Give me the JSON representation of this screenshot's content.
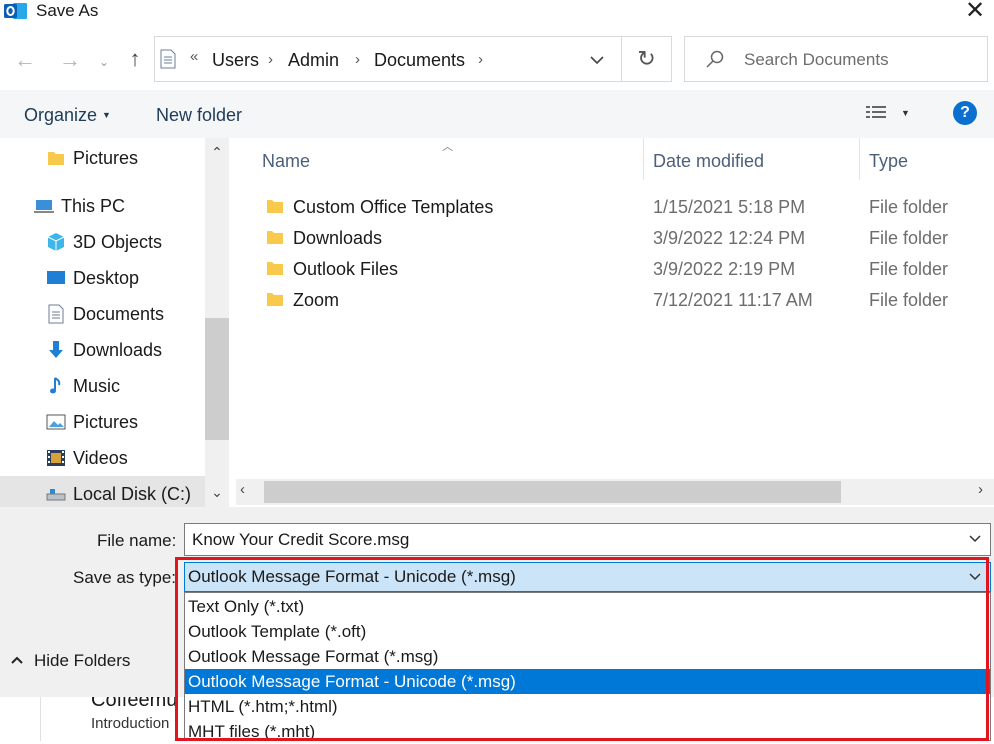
{
  "window": {
    "title": "Save As",
    "close_label": "✕"
  },
  "nav": {
    "back": "←",
    "forward": "→",
    "recent": "⌄",
    "up": "↑",
    "breadcrumb_more": "«",
    "breadcrumbs": [
      "Users",
      "Admin",
      "Documents"
    ],
    "separator": "›",
    "refresh": "↻"
  },
  "search": {
    "placeholder": "Search Documents"
  },
  "toolbar": {
    "organize": "Organize",
    "new_folder": "New folder",
    "help": "?"
  },
  "nav_pane": {
    "items": [
      {
        "label": "Pictures",
        "icon": "folder-icon"
      },
      {
        "label": "This PC",
        "icon": "computer-icon"
      },
      {
        "label": "3D Objects",
        "icon": "3d-objects-icon"
      },
      {
        "label": "Desktop",
        "icon": "desktop-icon"
      },
      {
        "label": "Documents",
        "icon": "documents-icon"
      },
      {
        "label": "Downloads",
        "icon": "downloads-icon"
      },
      {
        "label": "Music",
        "icon": "music-icon"
      },
      {
        "label": "Pictures",
        "icon": "pictures-icon"
      },
      {
        "label": "Videos",
        "icon": "videos-icon"
      },
      {
        "label": "Local Disk (C:)",
        "icon": "drive-icon",
        "selected": true
      }
    ]
  },
  "file_list": {
    "columns": [
      "Name",
      "Date modified",
      "Type"
    ],
    "rows": [
      {
        "name": "Custom Office Templates",
        "date": "1/15/2021 5:18 PM",
        "type": "File folder"
      },
      {
        "name": "Downloads",
        "date": "3/9/2022 12:24 PM",
        "type": "File folder"
      },
      {
        "name": "Outlook Files",
        "date": "3/9/2022 2:19 PM",
        "type": "File folder"
      },
      {
        "name": "Zoom",
        "date": "7/12/2021 11:17 AM",
        "type": "File folder"
      }
    ]
  },
  "form": {
    "file_name_label": "File name:",
    "file_name_value": "Know Your Credit Score.msg",
    "save_type_label": "Save as type:",
    "save_type_value": "Outlook Message Format - Unicode (*.msg)",
    "save_type_options": [
      {
        "label": "Text Only (*.txt)",
        "selected": false
      },
      {
        "label": "Outlook Template (*.oft)",
        "selected": false
      },
      {
        "label": "Outlook Message Format (*.msg)",
        "selected": false
      },
      {
        "label": "Outlook Message Format - Unicode (*.msg)",
        "selected": true
      },
      {
        "label": "HTML (*.htm;*.html)",
        "selected": false
      },
      {
        "label": "MHT files (*.mht)",
        "selected": false
      }
    ]
  },
  "footer": {
    "hide_folders": "Hide Folders"
  },
  "background": {
    "title": "Coffeemu",
    "subtitle": "Introduction"
  },
  "colors": {
    "accent": "#0078d7",
    "highlight": "#e2141f",
    "selection": "#cce4f7",
    "folder": "#f8c94a"
  }
}
